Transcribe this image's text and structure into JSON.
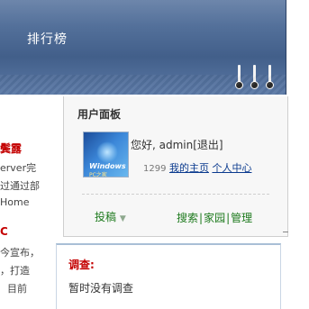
{
  "nav": {
    "item": "排行榜"
  },
  "left_column": [
    {
      "text": "鬓露",
      "style": "red"
    },
    {
      "text": "erver完",
      "style": "normal"
    },
    {
      "text": "过通过部",
      "style": "normal"
    },
    {
      "text": "Home",
      "style": "normal"
    },
    {
      "text": "C",
      "style": "red"
    },
    {
      "text": "今宣布，",
      "style": "normal"
    },
    {
      "text": "，打造",
      "style": "normal"
    },
    {
      "text": "目前",
      "style": "normal"
    }
  ],
  "user_panel": {
    "title": "用户面板",
    "avatar": {
      "logo": "Windows",
      "sub": "PC之家"
    },
    "greeting": "您好, admin",
    "logout": "[退出]",
    "points": "1299",
    "my_home": "我的主页",
    "user_center": "个人中心",
    "submit": "投稿",
    "links": [
      "搜索",
      "家园",
      "管理"
    ]
  },
  "survey": {
    "title": "调查:",
    "text": "暂时没有调查"
  },
  "colors": {
    "nav_blue": "#53709a",
    "headline_red": "#c40000",
    "link_green": "#1d7a1d",
    "link_blue": "#0a3a8e"
  }
}
